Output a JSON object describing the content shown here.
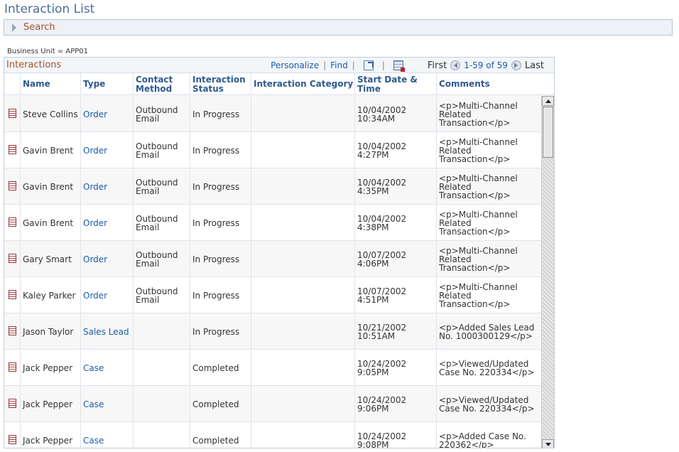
{
  "page": {
    "title": "Interaction List"
  },
  "search": {
    "label": "Search"
  },
  "business_unit": "Business Unit = APP01",
  "grid": {
    "title": "Interactions",
    "nav": {
      "personalize": "Personalize",
      "find": "Find",
      "first": "First",
      "range": "1-59 of 59",
      "last": "Last",
      "zoom_icon": "new-window-icon",
      "download_icon": "download-spreadsheet-icon"
    },
    "columns": [
      "Name",
      "Type",
      "Contact\nMethod",
      "Interaction\nStatus",
      "Interaction Category",
      "Start Date &\nTime",
      "Comments"
    ],
    "rows": [
      {
        "name": "Steve Collins",
        "type": "Order",
        "method": "Outbound\nEmail",
        "status": "In Progress",
        "category": "",
        "start": "10/04/2002\n10:34AM",
        "comments": "<p>Multi-Channel\nRelated\nTransaction</p>"
      },
      {
        "name": "Gavin Brent",
        "type": "Order",
        "method": "Outbound\nEmail",
        "status": "In Progress",
        "category": "",
        "start": "10/04/2002\n4:27PM",
        "comments": "<p>Multi-Channel\nRelated\nTransaction</p>"
      },
      {
        "name": "Gavin Brent",
        "type": "Order",
        "method": "Outbound\nEmail",
        "status": "In Progress",
        "category": "",
        "start": "10/04/2002\n4:35PM",
        "comments": "<p>Multi-Channel\nRelated\nTransaction</p>"
      },
      {
        "name": "Gavin Brent",
        "type": "Order",
        "method": "Outbound\nEmail",
        "status": "In Progress",
        "category": "",
        "start": "10/04/2002\n4:38PM",
        "comments": "<p>Multi-Channel\nRelated\nTransaction</p>"
      },
      {
        "name": "Gary Smart",
        "type": "Order",
        "method": "Outbound\nEmail",
        "status": "In Progress",
        "category": "",
        "start": "10/07/2002\n4:06PM",
        "comments": "<p>Multi-Channel\nRelated\nTransaction</p>"
      },
      {
        "name": "Kaley Parker",
        "type": "Order",
        "method": "Outbound\nEmail",
        "status": "In Progress",
        "category": "",
        "start": "10/07/2002\n4:51PM",
        "comments": "<p>Multi-Channel\nRelated\nTransaction</p>"
      },
      {
        "name": "Jason Taylor",
        "type": "Sales Lead",
        "method": "",
        "status": "In Progress",
        "category": "",
        "start": "10/21/2002\n10:51AM",
        "comments": "<p>Added Sales Lead\nNo. 1000300129</p>"
      },
      {
        "name": "Jack Pepper",
        "type": "Case",
        "method": "",
        "status": "Completed",
        "category": "",
        "start": "10/24/2002\n9:05PM",
        "comments": "<p>Viewed/Updated\nCase No. 220334</p>"
      },
      {
        "name": "Jack Pepper",
        "type": "Case",
        "method": "",
        "status": "Completed",
        "category": "",
        "start": "10/24/2002\n9:06PM",
        "comments": "<p>Viewed/Updated\nCase No. 220334</p>"
      },
      {
        "name": "Jack Pepper",
        "type": "Case",
        "method": "",
        "status": "Completed",
        "category": "",
        "start": "10/24/2002\n9:08PM",
        "comments": "<p>Added Case No.\n220362</p>"
      }
    ]
  },
  "icons": {
    "row_icon": "interaction-detail-icon",
    "expand": "expand-triangle-icon"
  }
}
